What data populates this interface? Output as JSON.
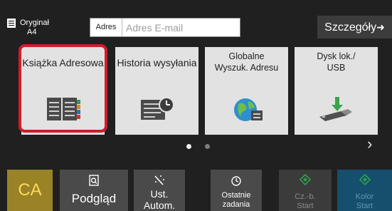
{
  "original": {
    "label": "Oryginał",
    "size": "A4",
    "icon": "document-icon"
  },
  "address": {
    "tag": "Adres",
    "placeholder": "Adres E-mail"
  },
  "details": {
    "label": "Szczegóły",
    "icon": "arrow-right-icon"
  },
  "tiles": [
    {
      "label": "Książka Adresowa",
      "icon": "address-book-icon",
      "selected": true
    },
    {
      "label": "Historia wysyłania",
      "icon": "send-history-icon",
      "selected": false
    },
    {
      "label_line1": "Globalne",
      "label_line2": "Wyszuk. Adresu",
      "icon": "globe-search-icon",
      "selected": false
    },
    {
      "label_line1": "Dysk lok./",
      "label_line2": "USB",
      "icon": "usb-drive-icon",
      "selected": false
    }
  ],
  "pagination": {
    "pages": 2,
    "current": 1
  },
  "next_icon": "chevron-right-icon",
  "bottom": {
    "ca": "CA",
    "preview": "Podgląd",
    "auto_line1": "Ust.",
    "auto_line2": "Autom.",
    "recent_line1": "Ostatnie",
    "recent_line2": "zadania",
    "bw_line1": "Cz.-b.",
    "bw_line2": "Start",
    "color_line1": "Kolor",
    "color_line2": "Start"
  },
  "colors": {
    "selection": "#d01d2b",
    "ca_bg": "#9a8227",
    "color_start_bg": "#164f6e",
    "start_led": "#2aa24a"
  }
}
